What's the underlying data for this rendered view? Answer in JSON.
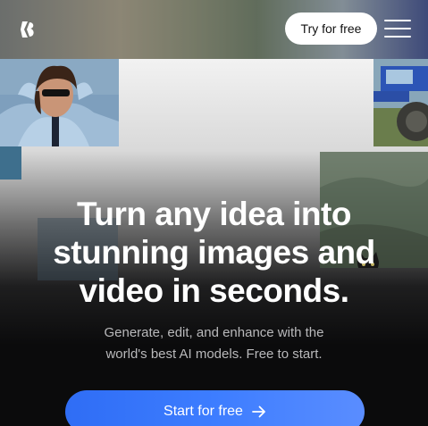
{
  "header": {
    "logo_icon": "brand-logo-icon",
    "try_button_label": "Try for free",
    "menu_icon": "hamburger-menu-icon"
  },
  "hero": {
    "title_lines": [
      "Turn any idea into",
      "stunning images and",
      "video in seconds."
    ],
    "subtitle_lines": [
      "Generate, edit, and enhance with the",
      "world's best AI models. Free to start."
    ],
    "cta_label": "Start for free",
    "cta_icon": "arrow-right-icon"
  },
  "colors": {
    "accent_blue": "#3d7dff",
    "background_dark": "#0b0b0c",
    "button_white": "#ffffff"
  }
}
